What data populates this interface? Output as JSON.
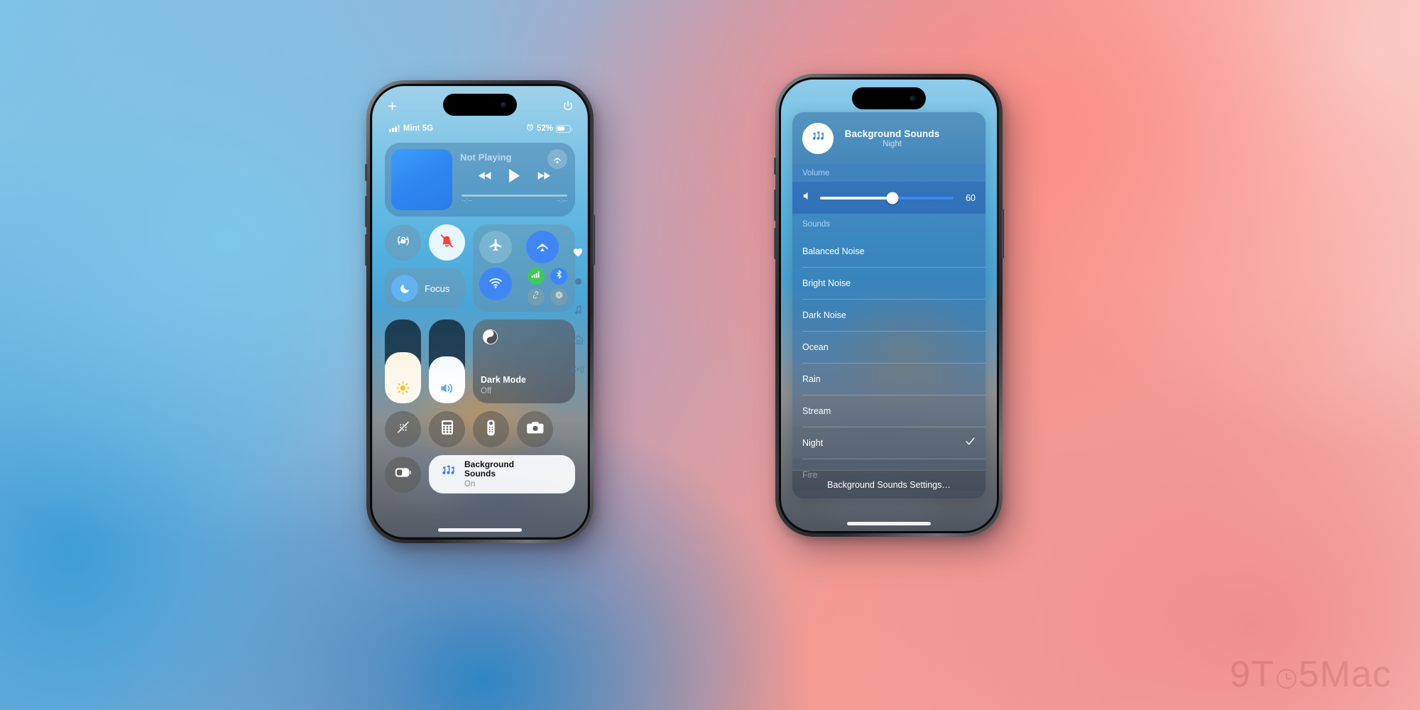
{
  "watermark": "9TO5Mac",
  "phone1": {
    "name": "iphone-control-center",
    "top_icons": {
      "add": "plus-icon",
      "power": "power-icon"
    },
    "statusbar": {
      "carrier": "Mint 5G",
      "signal_icon": "signal-bars-icon",
      "alarm_icon": "alarm-clock-icon",
      "battery_percent": "52%",
      "battery_icon": "battery-icon",
      "battery_level": 52
    },
    "media": {
      "title": "Not Playing",
      "airplay_icon": "airplay-icon",
      "prev_icon": "rewind-icon",
      "play_icon": "play-icon",
      "next_icon": "fast-forward-icon",
      "elapsed": "--:--",
      "remaining": "--:--"
    },
    "toggles": {
      "rotation_lock": "rotation-lock-icon",
      "silent_mode": "bell-slash-icon",
      "focus_label": "Focus",
      "focus_icon": "moon-icon",
      "airplane": "airplane-icon",
      "airdrop": "airdrop-icon",
      "wifi": "wifi-icon",
      "cellular": "cellular-icon",
      "bluetooth": "bluetooth-icon",
      "hotspot": "personal-hotspot-icon",
      "vpn": "vpn-icon"
    },
    "sliders": {
      "brightness_icon": "brightness-icon",
      "brightness_value": 61,
      "volume_icon": "speaker-icon",
      "volume_value": 56
    },
    "dark_mode": {
      "title": "Dark Mode",
      "status": "Off",
      "icon": "dark-mode-icon"
    },
    "bottom_controls": [
      {
        "name": "screen-mirroring-icon",
        "label": "Screen Mirroring"
      },
      {
        "name": "calculator-icon",
        "label": "Calculator"
      },
      {
        "name": "apple-tv-remote-icon",
        "label": "Apple TV Remote"
      },
      {
        "name": "camera-icon",
        "label": "Camera"
      }
    ],
    "low_power": {
      "icon": "low-power-mode-icon"
    },
    "background_sounds_pill": {
      "icon": "music-notes-icon",
      "title_line1": "Background",
      "title_line2": "Sounds",
      "status": "On"
    },
    "side_pages": [
      "heart-icon",
      "page-dot-icon",
      "music-note-icon",
      "home-icon",
      "connectivity-icon"
    ]
  },
  "phone2": {
    "name": "background-sounds-panel",
    "header": {
      "icon": "music-notes-icon",
      "title": "Background Sounds",
      "subtitle": "Night"
    },
    "volume_section": {
      "label": "Volume",
      "speaker_icon": "speaker-icon",
      "value": "60",
      "percent": 54
    },
    "sounds_section": {
      "label": "Sounds",
      "items": [
        {
          "label": "Balanced Noise",
          "selected": false
        },
        {
          "label": "Bright Noise",
          "selected": false
        },
        {
          "label": "Dark Noise",
          "selected": false
        },
        {
          "label": "Ocean",
          "selected": false
        },
        {
          "label": "Rain",
          "selected": false
        },
        {
          "label": "Stream",
          "selected": false
        },
        {
          "label": "Night",
          "selected": true
        },
        {
          "label": "Fire",
          "selected": false
        }
      ],
      "check_icon": "checkmark-icon"
    },
    "footer": {
      "label": "Background Sounds Settings…"
    }
  },
  "colors": {
    "accent_blue": "#3f86f5",
    "green": "#41c85b",
    "silent_red": "#f2443a",
    "white": "#ffffff"
  }
}
